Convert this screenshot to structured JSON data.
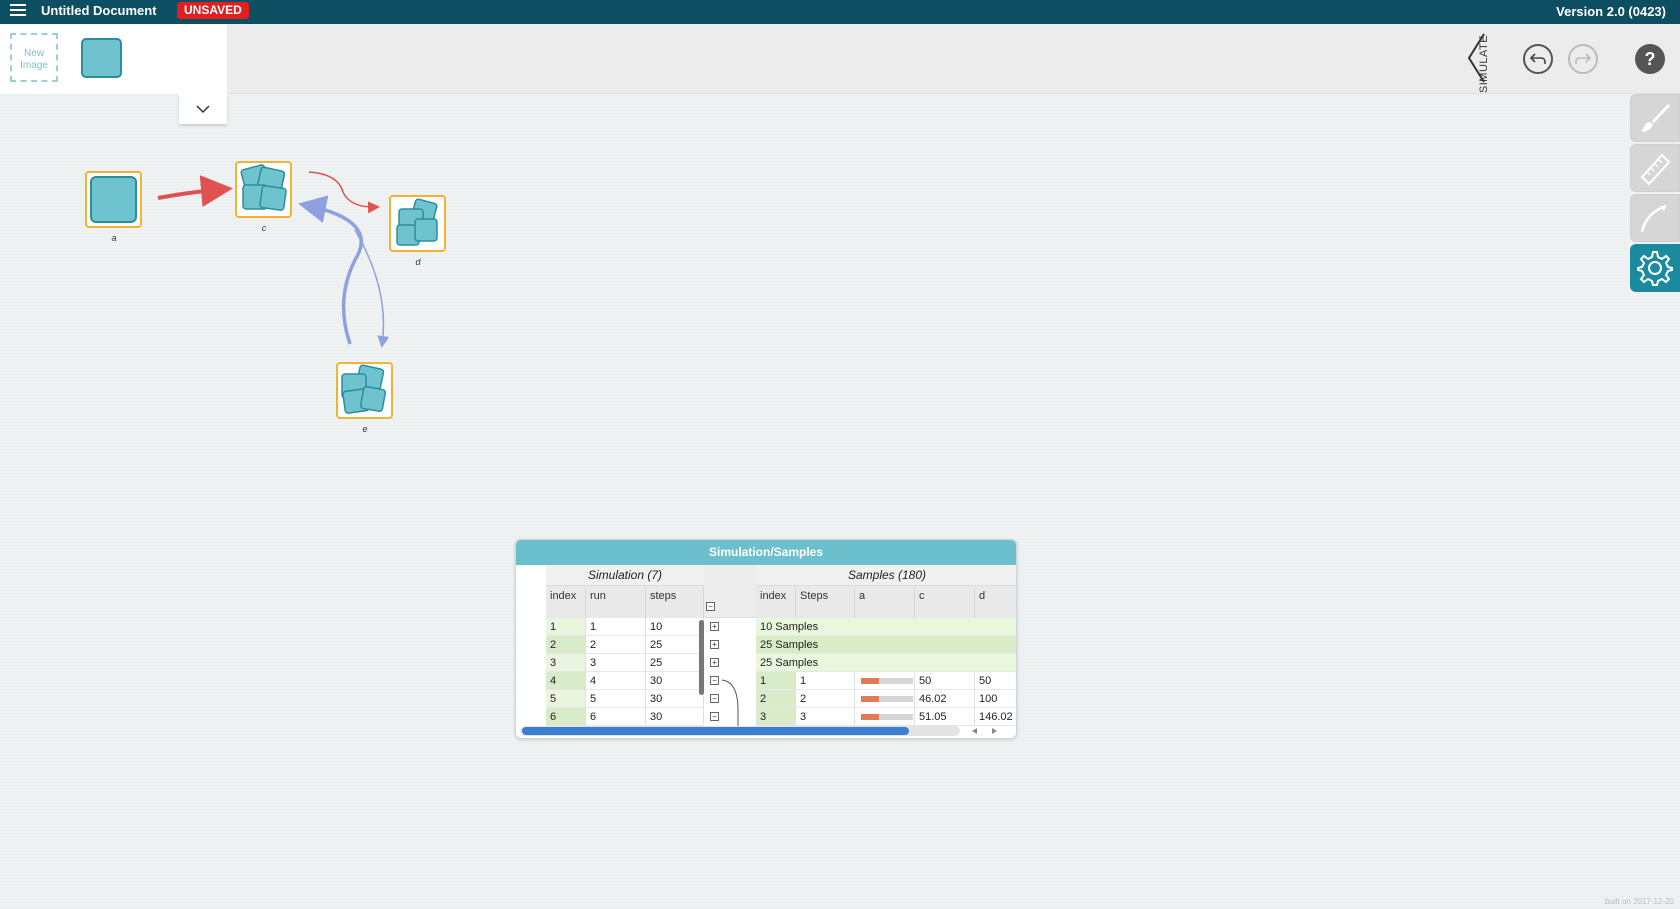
{
  "header": {
    "title": "Untitled Document",
    "status_badge": "UNSAVED",
    "version": "Version 2.0 (0423)"
  },
  "palette": {
    "new_image_label": "New Image"
  },
  "toolbar": {
    "simulate_label": "SIMULATE"
  },
  "help_label": "?",
  "nodes": [
    {
      "id": "a",
      "label": "a",
      "type": "single"
    },
    {
      "id": "c",
      "label": "c",
      "type": "collection"
    },
    {
      "id": "d",
      "label": "d",
      "type": "collection"
    },
    {
      "id": "e",
      "label": "e",
      "type": "collection"
    }
  ],
  "colors": {
    "topbar": "#0e4e62",
    "node_fill": "#6fc3cf",
    "node_border": "#f2b233",
    "link_red": "#e05252",
    "link_blue": "#8fa0e0",
    "panel_title": "#6cbfcc",
    "active_tool": "#1c8a9e"
  },
  "side_tools": [
    "brush-icon",
    "ruler-icon",
    "curve-icon",
    "gear-icon"
  ],
  "table": {
    "title": "Simulation/Samples",
    "sim_group": "Simulation (7)",
    "samples_group": "Samples (180)",
    "sim_columns": [
      "index",
      "run",
      "steps"
    ],
    "sample_columns": [
      "index",
      "Steps",
      "a",
      "c",
      "d"
    ],
    "sim_rows": [
      {
        "index": "1",
        "run": "1",
        "steps": "10",
        "expanded": false,
        "summary": "10 Samples"
      },
      {
        "index": "2",
        "run": "2",
        "steps": "25",
        "expanded": false,
        "summary": "25 Samples"
      },
      {
        "index": "3",
        "run": "3",
        "steps": "25",
        "expanded": false,
        "summary": "25 Samples"
      },
      {
        "index": "4",
        "run": "4",
        "steps": "30",
        "expanded": true,
        "summary": ""
      },
      {
        "index": "5",
        "run": "5",
        "steps": "30",
        "expanded": true,
        "summary": ""
      },
      {
        "index": "6",
        "run": "6",
        "steps": "30",
        "expanded": true,
        "summary": ""
      }
    ],
    "sample_rows": [
      {
        "index": "1",
        "steps": "1",
        "a_fraction": 0.35,
        "c": "50",
        "d": "50"
      },
      {
        "index": "2",
        "steps": "2",
        "a_fraction": 0.35,
        "c": "46.02",
        "d": "100"
      },
      {
        "index": "3",
        "steps": "3",
        "a_fraction": 0.35,
        "c": "51.05",
        "d": "146.02"
      }
    ]
  },
  "footer": "built on 2017-12-20"
}
